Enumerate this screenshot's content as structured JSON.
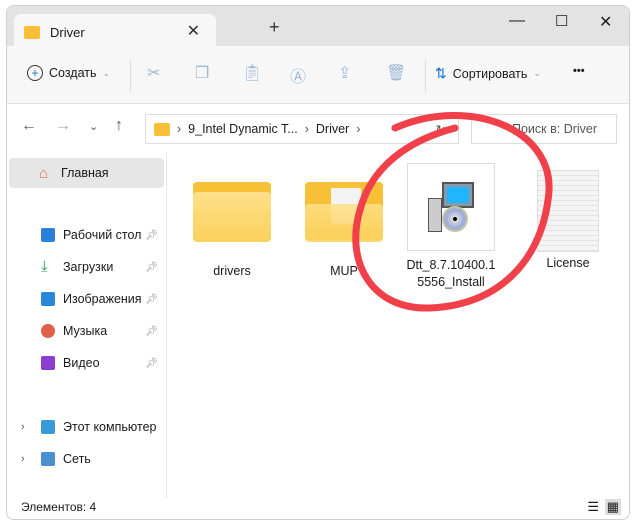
{
  "window": {
    "tab_title": "Driver",
    "new_tab": "+"
  },
  "toolbar": {
    "create": "Создать",
    "sort": "Сортировать",
    "more": "•••"
  },
  "address": {
    "crumbs": [
      "9_Intel Dynamic T...",
      "Driver"
    ],
    "search_placeholder": "Поиск в: Driver"
  },
  "sidebar": {
    "home": "Главная",
    "pinned": [
      {
        "label": "Рабочий стол",
        "color": "#2b7fd6"
      },
      {
        "label": "Загрузки",
        "color": "#1e9e5a"
      },
      {
        "label": "Изображения",
        "color": "#2b88d8"
      },
      {
        "label": "Музыка",
        "color": "#e0614a"
      },
      {
        "label": "Видео",
        "color": "#8a3ed1"
      }
    ],
    "tree": [
      {
        "label": "Этот компьютер"
      },
      {
        "label": "Сеть"
      }
    ]
  },
  "files": [
    {
      "name": "drivers",
      "type": "folder"
    },
    {
      "name": "MUP",
      "type": "folder"
    },
    {
      "name": "Dtt_8.7.10400.15556_Install",
      "type": "installer",
      "selected": true
    },
    {
      "name": "License",
      "type": "text"
    }
  ],
  "status": {
    "count": "Элементов: 4"
  },
  "annotation_color": "#f0404a"
}
